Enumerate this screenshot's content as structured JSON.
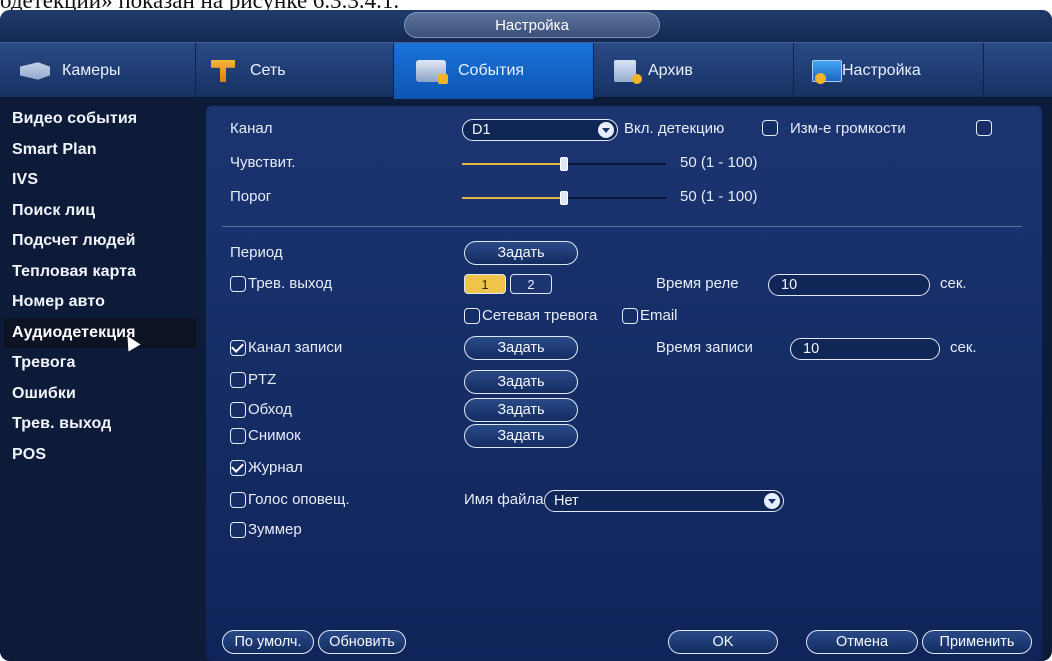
{
  "caption": "одетекции» показан на рисунке 6.3.3.4.1.",
  "window_title": "Настройка",
  "tabs": [
    {
      "label": "Камеры",
      "icon": "camera-icon"
    },
    {
      "label": "Сеть",
      "icon": "network-icon"
    },
    {
      "label": "События",
      "icon": "events-icon"
    },
    {
      "label": "Архив",
      "icon": "archive-icon"
    },
    {
      "label": "Настройка",
      "icon": "settings-icon"
    }
  ],
  "active_tab": "События",
  "sidebar": {
    "items": [
      {
        "label": "Видео события"
      },
      {
        "label": "Smart Plan"
      },
      {
        "label": "IVS"
      },
      {
        "label": "Поиск лиц"
      },
      {
        "label": "Подсчет людей"
      },
      {
        "label": "Тепловая карта"
      },
      {
        "label": "Номер авто"
      },
      {
        "label": "Аудиодетекция"
      },
      {
        "label": "Тревога"
      },
      {
        "label": "Ошибки"
      },
      {
        "label": "Трев. выход"
      },
      {
        "label": "POS"
      }
    ],
    "active": "Аудиодетекция"
  },
  "form": {
    "channel_label": "Канал",
    "channel_value": "D1",
    "enable_detect_label": "Вкл. детекцию",
    "enable_detect_checked": false,
    "volume_change_label": "Изм-е громкости",
    "volume_change_checked": false,
    "sensitivity_label": "Чувствит.",
    "sensitivity_value": 50,
    "sensitivity_text": "50 (1 - 100)",
    "threshold_label": "Порог",
    "threshold_value": 50,
    "threshold_text": "50 (1 - 100)",
    "period_label": "Период",
    "set_button": "Задать",
    "alarm_out_label": "Трев. выход",
    "alarm_out_checked": false,
    "alarm_out_channels": [
      "1",
      "2"
    ],
    "relay_time_label": "Время реле",
    "relay_time_value": "10",
    "sec_label": "сек.",
    "net_alarm_label": "Сетевая тревога",
    "net_alarm_checked": false,
    "email_label": "Email",
    "email_checked": false,
    "record_channel_label": "Канал записи",
    "record_channel_checked": true,
    "record_time_label": "Время записи",
    "record_time_value": "10",
    "ptz_label": "PTZ",
    "ptz_checked": false,
    "tour_label": "Обход",
    "tour_checked": false,
    "snapshot_label": "Снимок",
    "snapshot_checked": false,
    "log_label": "Журнал",
    "log_checked": true,
    "voice_label": "Голос оповещ.",
    "voice_checked": false,
    "file_name_label": "Имя файла",
    "file_name_value": "Нет",
    "buzzer_label": "Зуммер",
    "buzzer_checked": false
  },
  "footer": {
    "default_btn": "По умолч.",
    "refresh_btn": "Обновить",
    "ok_btn": "OK",
    "cancel_btn": "Отмена",
    "apply_btn": "Применить"
  }
}
